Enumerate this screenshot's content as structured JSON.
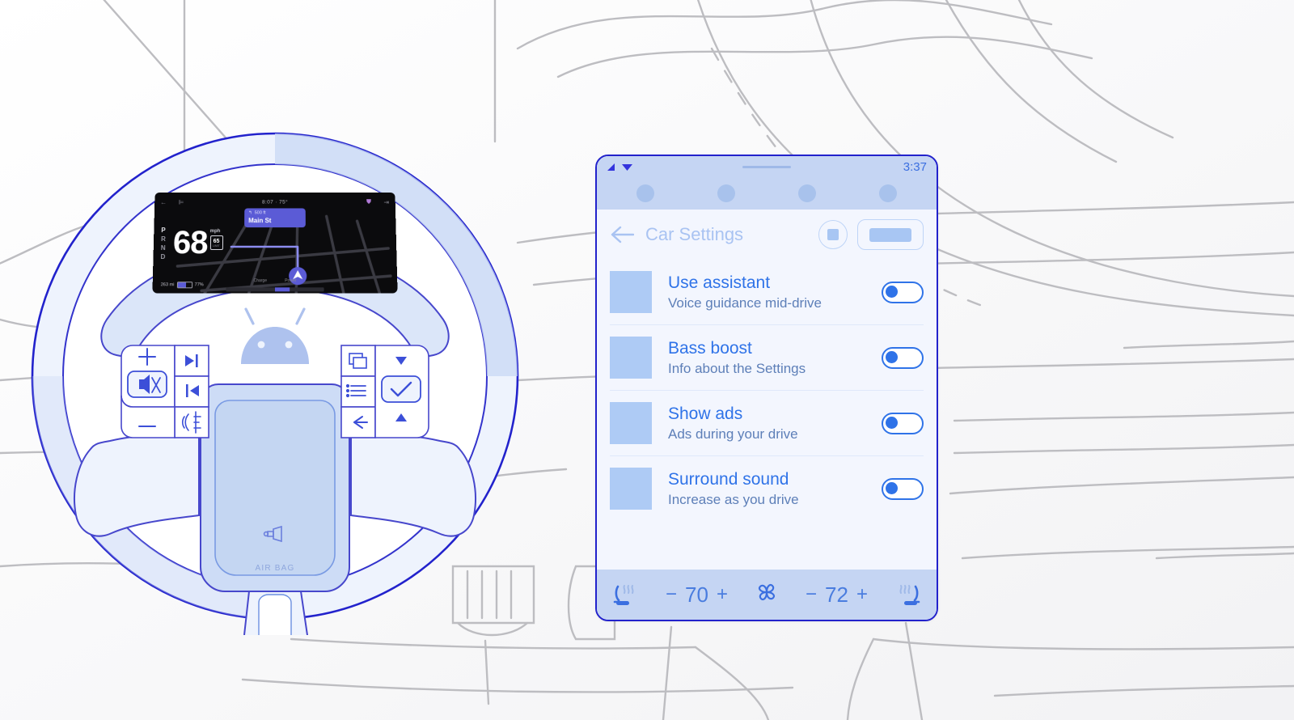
{
  "scene": {
    "title": "Android Auto car settings mockup",
    "colors": {
      "accent_blue": "#2f73e8",
      "outline_blue": "#2222cc",
      "panel_bg": "#f3f6fe",
      "status_bar_bg": "#c5d5f3",
      "icon_fill": "#aecbf5",
      "line_art": "#b9b9bd",
      "cluster_bg": "#0b0b0d",
      "nav_purple": "#5b5bd6"
    }
  },
  "cluster": {
    "status": {
      "left_icon": "headlight-icon",
      "back_icon": "back-arrow-icon",
      "center": "8:07 · 75°",
      "right_icon": "seatbelt-icon",
      "far_right_icon": "turn-signal-icon"
    },
    "gear": {
      "letters": [
        "P",
        "R",
        "N",
        "D"
      ],
      "selected": "P"
    },
    "speed": {
      "value": "68",
      "unit": "mph"
    },
    "speed_limit": {
      "value": "65",
      "unit": "LIMIT"
    },
    "nav_card": {
      "distance": "500 ft",
      "street": "Main St",
      "maneuver": "turn-left-icon"
    },
    "battery": {
      "range": "263 mi",
      "percent": "77%",
      "fill_ratio": 0.62
    },
    "power_meter": {
      "left_label": "Charge",
      "right_label": "Power"
    }
  },
  "wheel": {
    "center_logo": "android-robot-icon",
    "horn_label": "horn-icon",
    "airbag_label": "AIR BAG",
    "left_controls": [
      {
        "name": "volume-up-button",
        "glyph": "+"
      },
      {
        "name": "mute-button",
        "glyph": "mute-icon"
      },
      {
        "name": "volume-down-button",
        "glyph": "−"
      },
      {
        "name": "next-track-button",
        "glyph": "▶|"
      },
      {
        "name": "previous-track-button",
        "glyph": "|◀"
      },
      {
        "name": "voice-assistant-button",
        "glyph": "voice-icon"
      }
    ],
    "right_controls": [
      {
        "name": "apps-button",
        "glyph": "windows-icon"
      },
      {
        "name": "list-button",
        "glyph": "list-icon"
      },
      {
        "name": "back-button",
        "glyph": "←"
      },
      {
        "name": "up-button",
        "glyph": "▲"
      },
      {
        "name": "confirm-button",
        "glyph": "✓"
      },
      {
        "name": "down-button",
        "glyph": "▼"
      }
    ]
  },
  "tablet": {
    "status_bar": {
      "signal_icon": "signal-icon",
      "wifi_icon": "wifi-icon",
      "time": "3:37"
    },
    "app_dots": 4,
    "header": {
      "back_icon": "back-arrow-icon",
      "title": "Car Settings",
      "stop_button": "stop-button",
      "placeholder_button": "placeholder-button"
    },
    "settings_rows": [
      {
        "title": "Use assistant",
        "subtitle": "Voice guidance mid-drive",
        "toggle_on": false,
        "icon": "placeholder-icon"
      },
      {
        "title": "Bass boost",
        "subtitle": "Info about the Settings",
        "toggle_on": false,
        "icon": "placeholder-icon"
      },
      {
        "title": "Show ads",
        "subtitle": "Ads during your drive",
        "toggle_on": false,
        "icon": "placeholder-icon"
      },
      {
        "title": "Surround sound",
        "subtitle": "Increase as you drive",
        "toggle_on": false,
        "icon": "placeholder-icon"
      }
    ],
    "climate": {
      "left_seat_icon": "seat-heater-left-icon",
      "left_minus": "−",
      "left_temp": "70",
      "left_plus": "+",
      "fan_icon": "fan-icon",
      "right_minus": "−",
      "right_temp": "72",
      "right_plus": "+",
      "right_seat_icon": "seat-heater-right-icon"
    }
  }
}
